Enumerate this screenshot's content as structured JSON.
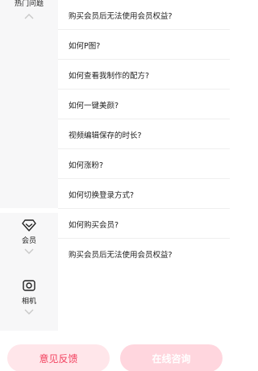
{
  "sidebar": {
    "categories": [
      {
        "label": "热门问题",
        "icon": "hot-icon"
      },
      {
        "label": "会员",
        "icon": "vip-diamond-icon"
      },
      {
        "label": "相机",
        "icon": "camera-icon"
      }
    ]
  },
  "questions": {
    "hot": [
      "购买会员后无法使用会员权益?",
      "如何P图?",
      "如何查看我制作的配方?",
      "如何一键美颜?",
      "视频编辑保存的时长?",
      "如何涨粉?",
      "如何切换登录方式?"
    ],
    "member": [
      "如何购买会员?",
      "购买会员后无法使用会员权益?"
    ]
  },
  "footer": {
    "feedback_label": "意见反馈",
    "online_label": "在线咨询"
  },
  "colors": {
    "accent": "#f2415f",
    "accent_light": "#ffe6ea"
  }
}
